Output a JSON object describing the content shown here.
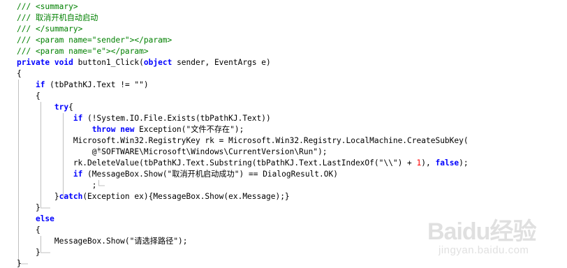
{
  "editor": {
    "lines": [
      [
        {
          "t": "/// ",
          "c": "comment"
        },
        {
          "t": "<summary>",
          "c": "comment"
        }
      ],
      [
        {
          "t": "/// 取消开机自动启动",
          "c": "comment"
        }
      ],
      [
        {
          "t": "/// ",
          "c": "comment"
        },
        {
          "t": "</summary>",
          "c": "comment"
        }
      ],
      [
        {
          "t": "/// ",
          "c": "comment"
        },
        {
          "t": "<param name=\"sender\"></param>",
          "c": "comment"
        }
      ],
      [
        {
          "t": "/// ",
          "c": "comment"
        },
        {
          "t": "<param name=\"e\"></param>",
          "c": "comment"
        }
      ],
      [
        {
          "t": "private",
          "c": "keyword"
        },
        {
          "t": " "
        },
        {
          "t": "void",
          "c": "keyword"
        },
        {
          "t": " button1_Click("
        },
        {
          "t": "object",
          "c": "keyword"
        },
        {
          "t": " sender, EventArgs e)"
        }
      ],
      [
        {
          "t": "{"
        }
      ],
      [
        {
          "t": "    "
        },
        {
          "t": "if",
          "c": "keyword"
        },
        {
          "t": " (tbPathKJ.Text != \"\")"
        }
      ],
      [
        {
          "t": "    {"
        }
      ],
      [
        {
          "t": "        "
        },
        {
          "t": "try",
          "c": "keyword"
        },
        {
          "t": "{"
        }
      ],
      [
        {
          "t": "            "
        },
        {
          "t": "if",
          "c": "keyword"
        },
        {
          "t": " (!System.IO.File.Exists(tbPathKJ.Text))"
        }
      ],
      [
        {
          "t": "                "
        },
        {
          "t": "throw",
          "c": "keyword"
        },
        {
          "t": " "
        },
        {
          "t": "new",
          "c": "keyword"
        },
        {
          "t": " Exception(\"文件不存在\");"
        }
      ],
      [
        {
          "t": "            Microsoft.Win32.RegistryKey rk = Microsoft.Win32.Registry.LocalMachine.CreateSubKey("
        }
      ],
      [
        {
          "t": "                @\"SOFTWARE\\Microsoft\\Windows\\CurrentVersion\\Run\");"
        }
      ],
      [
        {
          "t": "            rk.DeleteValue(tbPathKJ.Text.Substring(tbPathKJ.Text.LastIndexOf(\"\\\\\") + "
        },
        {
          "t": "1",
          "c": "number"
        },
        {
          "t": "), "
        },
        {
          "t": "false",
          "c": "keyword"
        },
        {
          "t": ");"
        }
      ],
      [
        {
          "t": "            "
        },
        {
          "t": "if",
          "c": "keyword"
        },
        {
          "t": " (MessageBox.Show(\"取消开机启动成功\") == DialogResult.OK)"
        }
      ],
      [
        {
          "t": "                ;"
        }
      ],
      [
        {
          "t": "        }"
        },
        {
          "t": "catch",
          "c": "keyword"
        },
        {
          "t": "(Exception ex){MessageBox.Show(ex.Message);}"
        }
      ],
      [
        {
          "t": "    }"
        }
      ],
      [
        {
          "t": "    "
        },
        {
          "t": "else",
          "c": "keyword"
        }
      ],
      [
        {
          "t": "    {"
        }
      ],
      [
        {
          "t": "        MessageBox.Show(\"请选择路径\");"
        }
      ],
      [
        {
          "t": "    }"
        }
      ],
      [
        {
          "t": "}"
        }
      ]
    ]
  },
  "watermark": {
    "logo": "Baidu经验",
    "sub": "jingyan.baidu.com"
  },
  "colors": {
    "comment": "#008000",
    "keyword": "#0000ff",
    "number": "#ff0000",
    "guide": "#c0c0c0",
    "background": "#ffffff"
  }
}
